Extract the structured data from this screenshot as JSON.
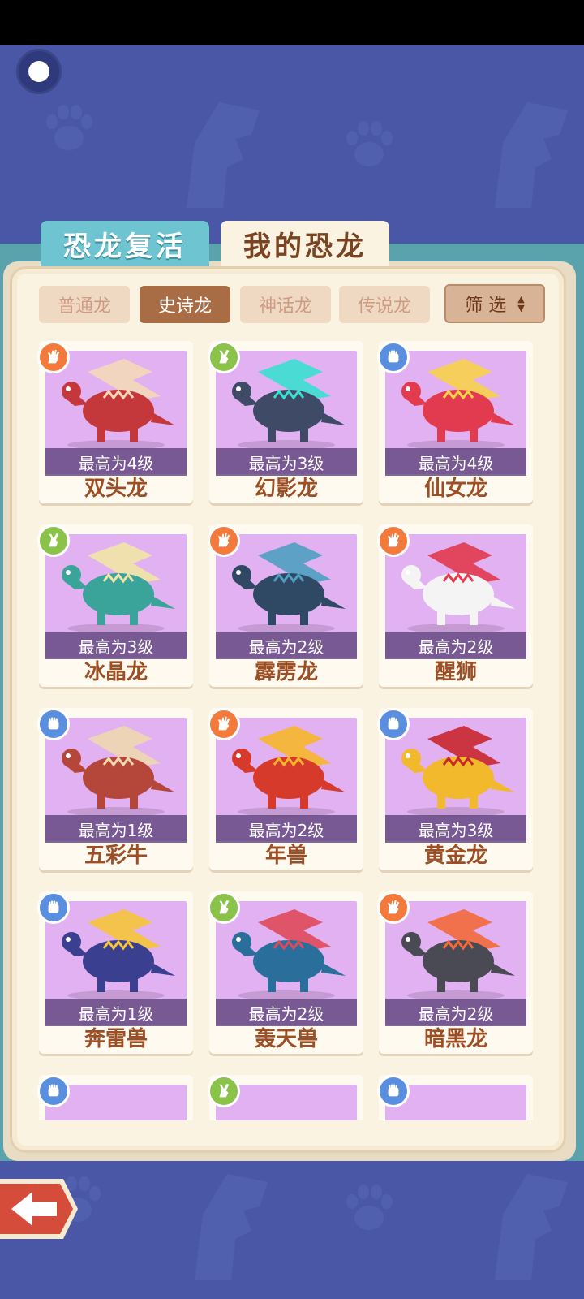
{
  "tabs": {
    "revive": "恐龙复活",
    "my": "我的恐龙"
  },
  "filters": [
    {
      "label": "普通龙",
      "active": false
    },
    {
      "label": "史诗龙",
      "active": true
    },
    {
      "label": "神话龙",
      "active": false
    },
    {
      "label": "传说龙",
      "active": false
    }
  ],
  "sort": {
    "label": "筛 选"
  },
  "colors": {
    "badge_orange": "#f47a3c",
    "badge_green": "#8bc24a",
    "badge_blue": "#5a8fe0",
    "card_art": "#e2b1f2"
  },
  "cards": [
    {
      "name": "双头龙",
      "level": "最高为4级",
      "badge": "orange",
      "icon": "hand-paper-icon",
      "creature_color": "#c4373b",
      "accent": "#f3d9b8"
    },
    {
      "name": "幻影龙",
      "level": "最高为3级",
      "badge": "green",
      "icon": "hand-scissors-icon",
      "creature_color": "#3e4a66",
      "accent": "#3be0d2"
    },
    {
      "name": "仙女龙",
      "level": "最高为4级",
      "badge": "blue",
      "icon": "hand-rock-icon",
      "creature_color": "#e23b4f",
      "accent": "#f7d24a"
    },
    {
      "name": "冰晶龙",
      "level": "最高为3级",
      "badge": "green",
      "icon": "hand-scissors-icon",
      "creature_color": "#3aa39a",
      "accent": "#f2e6a6"
    },
    {
      "name": "霹雳龙",
      "level": "最高为2级",
      "badge": "orange",
      "icon": "hand-paper-icon",
      "creature_color": "#2f4863",
      "accent": "#4fa0c2"
    },
    {
      "name": "醒狮",
      "level": "最高为2级",
      "badge": "orange",
      "icon": "hand-paper-icon",
      "creature_color": "#f4f4f4",
      "accent": "#e23b4f"
    },
    {
      "name": "五彩牛",
      "level": "最高为1级",
      "badge": "blue",
      "icon": "hand-rock-icon",
      "creature_color": "#b4473a",
      "accent": "#f0d8b0"
    },
    {
      "name": "年兽",
      "level": "最高为2级",
      "badge": "orange",
      "icon": "hand-paper-icon",
      "creature_color": "#d63a2a",
      "accent": "#f6b72b"
    },
    {
      "name": "黄金龙",
      "level": "最高为3级",
      "badge": "blue",
      "icon": "hand-rock-icon",
      "creature_color": "#f2b92c",
      "accent": "#c9272d"
    },
    {
      "name": "奔雷兽",
      "level": "最高为1级",
      "badge": "blue",
      "icon": "hand-rock-icon",
      "creature_color": "#3a3f8f",
      "accent": "#f6c53a"
    },
    {
      "name": "轰天兽",
      "level": "最高为2级",
      "badge": "green",
      "icon": "hand-scissors-icon",
      "creature_color": "#2a6f9c",
      "accent": "#e04a5a"
    },
    {
      "name": "暗黑龙",
      "level": "最高为2级",
      "badge": "orange",
      "icon": "hand-paper-icon",
      "creature_color": "#4a4a55",
      "accent": "#f26a3a"
    },
    {
      "name": "",
      "level": "",
      "badge": "blue",
      "icon": "hand-rock-icon",
      "creature_color": "",
      "accent": ""
    },
    {
      "name": "",
      "level": "",
      "badge": "green",
      "icon": "hand-scissors-icon",
      "creature_color": "",
      "accent": ""
    },
    {
      "name": "",
      "level": "",
      "badge": "blue",
      "icon": "hand-rock-icon",
      "creature_color": "",
      "accent": ""
    }
  ]
}
